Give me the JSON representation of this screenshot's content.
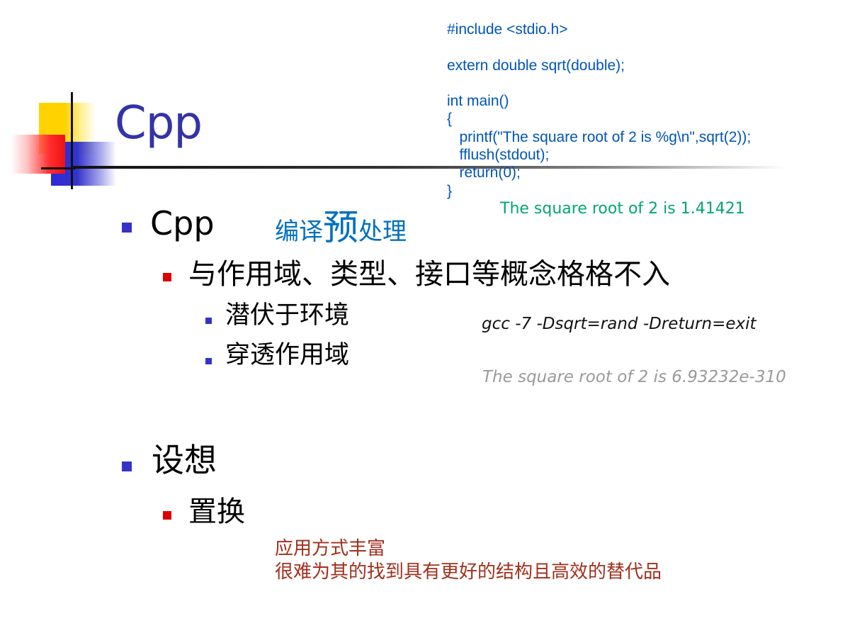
{
  "slide": {
    "title": "Cpp",
    "code_sample": "#include <stdio.h>\n\nextern double sqrt(double);\n\nint main()\n{\n   printf(\"The square root of 2 is %g\\n\",sqrt(2));\n   fflush(stdout);\n   return(0);\n}",
    "output_normal": "The square root of 2 is 1.41421",
    "gcc_command": "gcc -7 -Dsqrt=rand -Dreturn=exit",
    "output_substituted": "The square root of 2 is 6.93232e-310",
    "bullets": [
      {
        "label": "Cpp",
        "annotation": {
          "before": "编译",
          "emphasis": "预",
          "after": "处理"
        },
        "children": [
          {
            "label": "与作用域、类型、接口等概念格格不入",
            "children": [
              {
                "label": "潜伏于环境"
              },
              {
                "label": "穿透作用域"
              }
            ]
          }
        ]
      },
      {
        "label": "设想",
        "children": [
          {
            "label": "置换"
          }
        ]
      }
    ],
    "note_lines": [
      "应用方式丰富",
      "很难为其的找到具有更好的结构且高效的替代品"
    ]
  },
  "colors": {
    "title": "#3333a8",
    "code": "#0055b8",
    "output_normal": "#00a86b",
    "annotation": "#0070c0",
    "note": "#a0301c",
    "bullet_level1": "#3333cc",
    "bullet_level2": "#dd0000"
  }
}
